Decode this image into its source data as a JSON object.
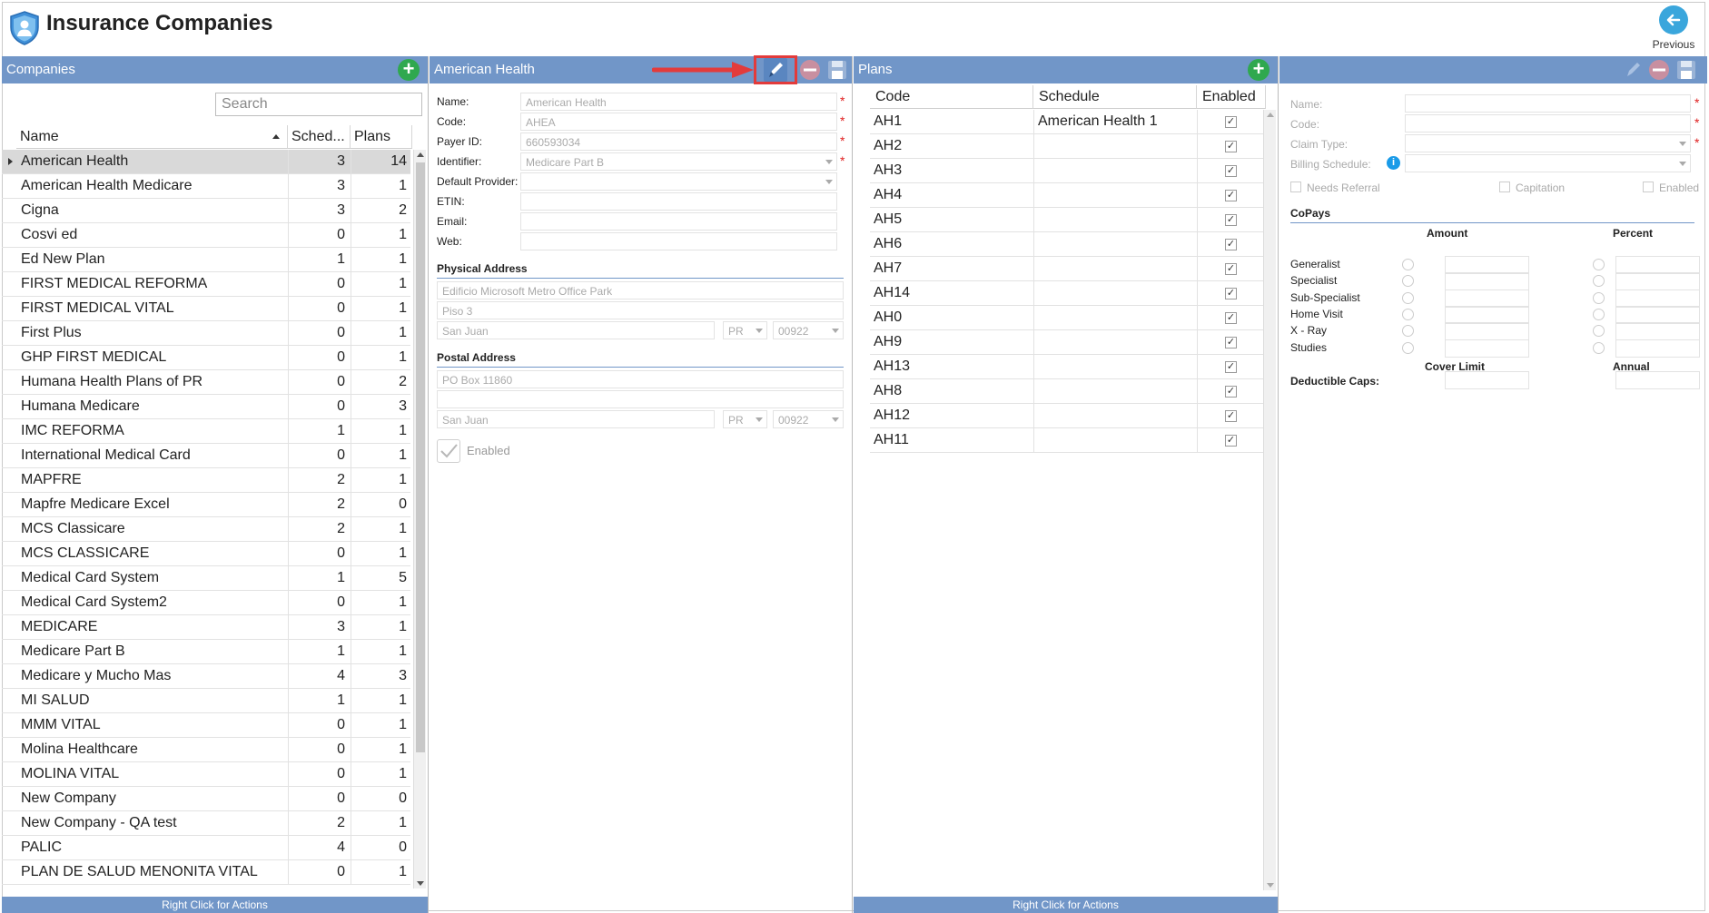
{
  "app": {
    "title": "Insurance Companies",
    "previous_label": "Previous"
  },
  "companies": {
    "header": "Companies",
    "search_placeholder": "Search",
    "columns": {
      "name": "Name",
      "schedules": "Sched...",
      "plans": "Plans"
    },
    "footer": "Right Click for Actions",
    "rows": [
      {
        "name": "American Health",
        "sched": "3",
        "plans": "14"
      },
      {
        "name": "American Health Medicare",
        "sched": "3",
        "plans": "1"
      },
      {
        "name": "Cigna",
        "sched": "3",
        "plans": "2"
      },
      {
        "name": "Cosvi ed",
        "sched": "0",
        "plans": "1"
      },
      {
        "name": "Ed New Plan",
        "sched": "1",
        "plans": "1"
      },
      {
        "name": "FIRST MEDICAL REFORMA",
        "sched": "0",
        "plans": "1"
      },
      {
        "name": "FIRST MEDICAL VITAL",
        "sched": "0",
        "plans": "1"
      },
      {
        "name": "First Plus",
        "sched": "0",
        "plans": "1"
      },
      {
        "name": "GHP FIRST MEDICAL",
        "sched": "0",
        "plans": "1"
      },
      {
        "name": "Humana Health Plans of PR",
        "sched": "0",
        "plans": "2"
      },
      {
        "name": "Humana Medicare",
        "sched": "0",
        "plans": "3"
      },
      {
        "name": "IMC REFORMA",
        "sched": "1",
        "plans": "1"
      },
      {
        "name": "International Medical Card",
        "sched": "0",
        "plans": "1"
      },
      {
        "name": "MAPFRE",
        "sched": "2",
        "plans": "1"
      },
      {
        "name": "Mapfre Medicare Excel",
        "sched": "2",
        "plans": "0"
      },
      {
        "name": "MCS Classicare",
        "sched": "2",
        "plans": "1"
      },
      {
        "name": "MCS CLASSICARE",
        "sched": "0",
        "plans": "1"
      },
      {
        "name": "Medical Card System",
        "sched": "1",
        "plans": "5"
      },
      {
        "name": "Medical Card System2",
        "sched": "0",
        "plans": "1"
      },
      {
        "name": "MEDICARE",
        "sched": "3",
        "plans": "1"
      },
      {
        "name": "Medicare Part B",
        "sched": "1",
        "plans": "1"
      },
      {
        "name": "Medicare y Mucho Mas",
        "sched": "4",
        "plans": "3"
      },
      {
        "name": "MI SALUD",
        "sched": "1",
        "plans": "1"
      },
      {
        "name": "MMM VITAL",
        "sched": "0",
        "plans": "1"
      },
      {
        "name": "Molina Healthcare",
        "sched": "0",
        "plans": "1"
      },
      {
        "name": "MOLINA VITAL",
        "sched": "0",
        "plans": "1"
      },
      {
        "name": "New Company",
        "sched": "0",
        "plans": "0"
      },
      {
        "name": "New Company - QA test",
        "sched": "2",
        "plans": "1"
      },
      {
        "name": "PALIC",
        "sched": "4",
        "plans": "0"
      },
      {
        "name": "PLAN DE SALUD MENONITA VITAL",
        "sched": "0",
        "plans": "1"
      }
    ]
  },
  "detail": {
    "header": "American Health",
    "labels": {
      "name": "Name:",
      "code": "Code:",
      "payer_id": "Payer ID:",
      "identifier": "Identifier:",
      "default_provider": "Default Provider:",
      "etin": "ETIN:",
      "email": "Email:",
      "web": "Web:"
    },
    "values": {
      "name": "American Health",
      "code": "AHEA",
      "payer_id": "660593034",
      "identifier": "Medicare Part B",
      "default_provider": "",
      "etin": "",
      "email": "",
      "web": ""
    },
    "physical_address_title": "Physical Address",
    "physical": {
      "line1": "Edificio Microsoft  Metro Office Park",
      "line2": "Piso 3",
      "city": "San Juan",
      "state": "PR",
      "zip": "00922"
    },
    "postal_address_title": "Postal Address",
    "postal": {
      "line1": "PO Box 11860",
      "line2": "",
      "city": "San Juan",
      "state": "PR",
      "zip": "00922"
    },
    "enabled_label": "Enabled"
  },
  "plans": {
    "header": "Plans",
    "columns": {
      "code": "Code",
      "schedule": "Schedule",
      "enabled": "Enabled"
    },
    "footer": "Right Click for Actions",
    "check_glyph": "✓",
    "rows": [
      {
        "code": "AH1",
        "schedule": "American Health 1"
      },
      {
        "code": "AH2",
        "schedule": ""
      },
      {
        "code": "AH3",
        "schedule": ""
      },
      {
        "code": "AH4",
        "schedule": ""
      },
      {
        "code": "AH5",
        "schedule": ""
      },
      {
        "code": "AH6",
        "schedule": ""
      },
      {
        "code": "AH7",
        "schedule": ""
      },
      {
        "code": "AH14",
        "schedule": ""
      },
      {
        "code": "AH0",
        "schedule": ""
      },
      {
        "code": "AH9",
        "schedule": ""
      },
      {
        "code": "AH13",
        "schedule": ""
      },
      {
        "code": "AH8",
        "schedule": ""
      },
      {
        "code": "AH12",
        "schedule": ""
      },
      {
        "code": "AH11",
        "schedule": ""
      }
    ]
  },
  "plan_detail": {
    "labels": {
      "name": "Name:",
      "code": "Code:",
      "claim_type": "Claim Type:",
      "billing_schedule": "Billing Schedule:"
    },
    "needs_referral": "Needs Referral",
    "capitation": "Capitation",
    "enabled": "Enabled",
    "copays_title": "CoPays",
    "amount_header": "Amount",
    "percent_header": "Percent",
    "copay_rows": [
      "Generalist",
      "Specialist",
      "Sub-Specialist",
      "Home Visit",
      "X - Ray",
      "Studies"
    ],
    "cover_limit": "Cover Limit",
    "annual": "Annual",
    "deductible_caps": "Deductible Caps:"
  },
  "colors": {
    "header_blue": "#7196c8",
    "add_green": "#2fa84f",
    "highlight_red": "#e33b3b",
    "required_red": "#e02020"
  }
}
